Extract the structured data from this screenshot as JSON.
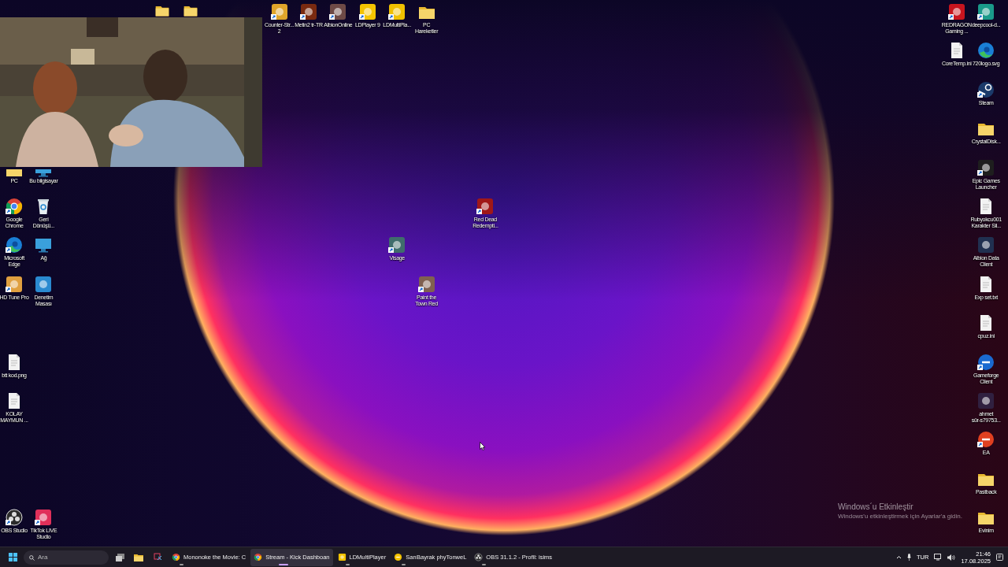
{
  "desktop_icons": [
    {
      "label": "Counter-Str...\n2"
    },
    {
      "label": "Metin2 tr-TR"
    },
    {
      "label": "AlbionOnline"
    },
    {
      "label": "LDPlayer 9"
    },
    {
      "label": "LDMultiPla..."
    },
    {
      "label": "PC\nHareketler"
    },
    {
      "label": "REDRAGON\nGaming ..."
    },
    {
      "label": "deepcool-d..."
    },
    {
      "label": "CoreTemp.ini"
    },
    {
      "label": "720logo.svg"
    },
    {
      "label": "Steam"
    },
    {
      "label": "CrystalDisk..."
    },
    {
      "label": "PC"
    },
    {
      "label": "Bu bilgisayar"
    },
    {
      "label": "Epic Games\nLauncher"
    },
    {
      "label": "Google\nChrome"
    },
    {
      "label": "Geri\nDönüşü..."
    },
    {
      "label": "Red Dead\nRedempti..."
    },
    {
      "label": "Rubyokcu001\nKarakter Sil..."
    },
    {
      "label": "Microsoft\nEdge"
    },
    {
      "label": "Ağ"
    },
    {
      "label": "Visage"
    },
    {
      "label": "Albion Data\nClient"
    },
    {
      "label": "HD Tune Pro"
    },
    {
      "label": "Denetim\nMasası"
    },
    {
      "label": "Paint the\nTown Red"
    },
    {
      "label": "Exp set.txt"
    },
    {
      "label": "cpuz.ini"
    },
    {
      "label": "btt kod.png"
    },
    {
      "label": "Gameforge\nClient"
    },
    {
      "label": "KOLAY\nMAYMUN ..."
    },
    {
      "label": "ahmet\nsür-s79753..."
    },
    {
      "label": "EA"
    },
    {
      "label": "Pastback"
    },
    {
      "label": "OBS Studio"
    },
    {
      "label": "TikTok LIVE\nStudio"
    },
    {
      "label": "Evinim"
    }
  ],
  "activation_notice": {
    "title": "Windows´u Etkinleştir",
    "text": "Windows'u etkinleştirmek için Ayarlar'a gidin."
  },
  "taskbar": {
    "search": {
      "placeholder": "Ara"
    },
    "windows": [
      {
        "label": "Mononoke the Movie: C",
        "selected": false
      },
      {
        "label": "Stream - Kick Dashboan",
        "selected": true
      },
      {
        "label": "LDMultiPlayer",
        "selected": false
      },
      {
        "label": "SarıBayrak phyTonweL",
        "selected": false
      },
      {
        "label": "OBS 31.1.2 - Profil: isims",
        "selected": false
      }
    ],
    "language": "TUR",
    "time": "21:46",
    "date": "17.08.2025"
  }
}
